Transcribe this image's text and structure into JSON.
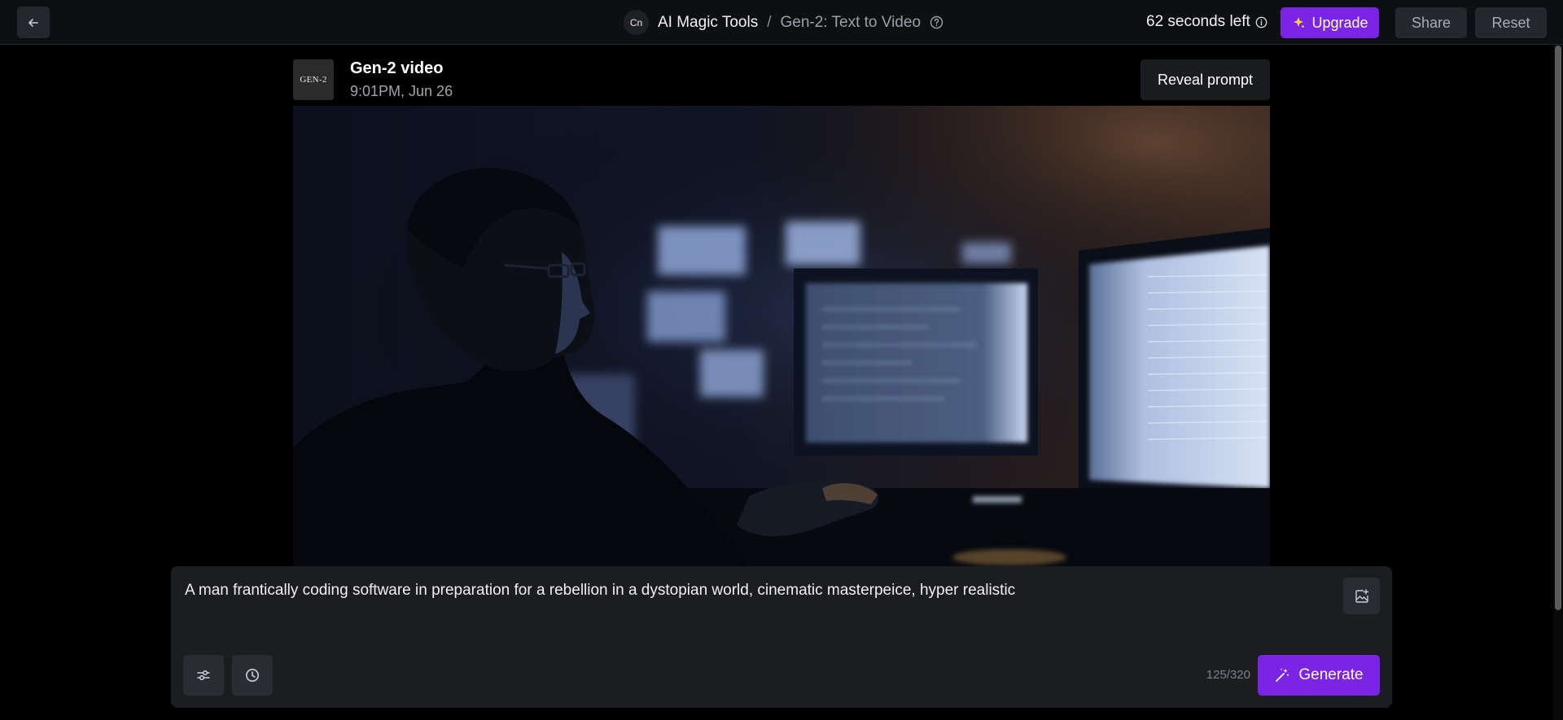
{
  "topbar": {
    "back_icon": "arrow-left-icon",
    "workspace_initials": "Cn",
    "breadcrumb_root": "AI Magic Tools",
    "breadcrumb_separator": "/",
    "breadcrumb_current": "Gen-2: Text to Video",
    "help_icon": "question-circle-icon",
    "timer_text": "62 seconds left",
    "timer_info_icon": "info-circle-icon",
    "upgrade_label": "Upgrade",
    "upgrade_icon": "sparkle-icon",
    "share_label": "Share",
    "reset_label": "Reset"
  },
  "video": {
    "thumbnail_text": "GEN-2",
    "title": "Gen-2 video",
    "date": "9:01PM, Jun 26",
    "reveal_prompt_label": "Reveal prompt"
  },
  "prompt": {
    "text": "A man frantically coding software in preparation for a rebellion in a dystopian world, cinematic masterpeice, hyper realistic",
    "char_count": "125/320",
    "image_upload_icon": "image-upload-icon",
    "settings_icon": "sliders-icon",
    "history_icon": "clock-icon",
    "generate_label": "Generate",
    "generate_icon": "magic-wand-icon"
  },
  "colors": {
    "accent": "#7b24e6",
    "background": "#000000",
    "panel": "#1c1d21",
    "button": "#25272c"
  }
}
